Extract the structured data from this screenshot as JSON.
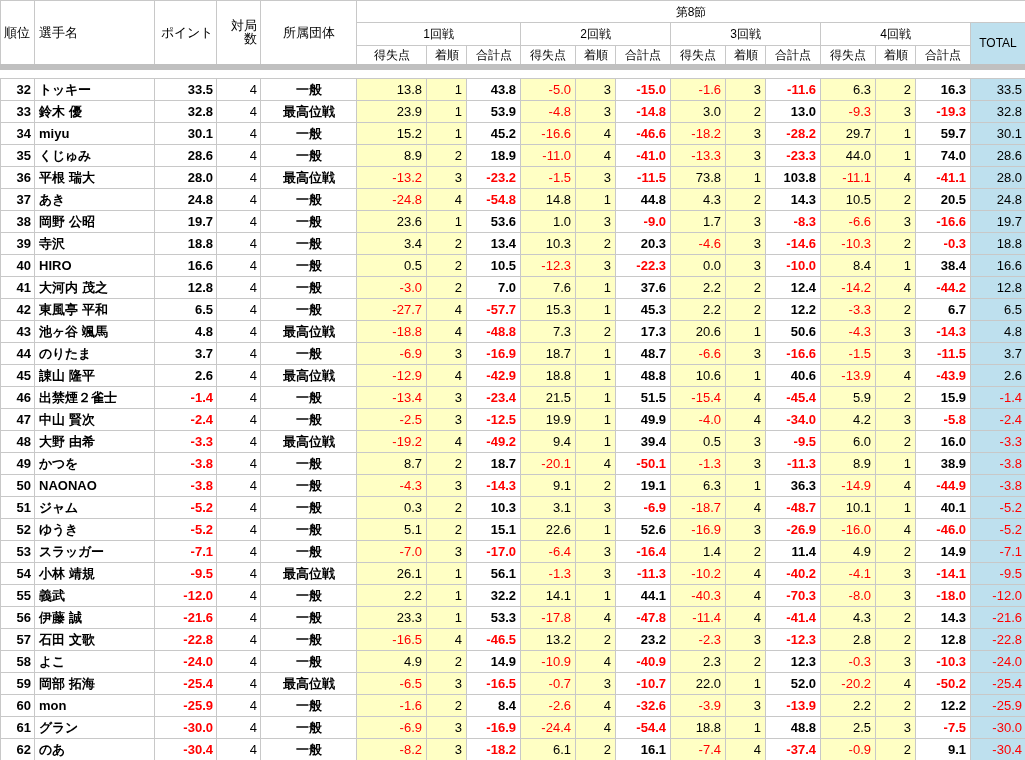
{
  "header": {
    "columns": [
      "順位",
      "選手名",
      "ポイント",
      "対局数",
      "所属団体"
    ],
    "section": "第8節",
    "rounds": [
      {
        "title": "1回戦",
        "columns": [
          "得失点",
          "着順",
          "合計点"
        ]
      },
      {
        "title": "2回戦",
        "columns": [
          "得失点",
          "着順",
          "合計点"
        ]
      },
      {
        "title": "3回戦",
        "columns": [
          "得失点",
          "着順",
          "合計点"
        ]
      },
      {
        "title": "4回戦",
        "columns": [
          "得失点",
          "着順",
          "合計点"
        ]
      }
    ],
    "total": "TOTAL"
  },
  "rows": [
    {
      "rank": "32",
      "name": "トッキー",
      "points": "33.5",
      "games": "4",
      "org": "一般",
      "rounds": [
        [
          "13.8",
          "1",
          "43.8"
        ],
        [
          "-5.0",
          "3",
          "-15.0"
        ],
        [
          "-1.6",
          "3",
          "-11.6"
        ],
        [
          "6.3",
          "2",
          "16.3"
        ]
      ],
      "total": "33.5"
    },
    {
      "rank": "33",
      "name": "鈴木 優",
      "points": "32.8",
      "games": "4",
      "org": "最高位戦",
      "rounds": [
        [
          "23.9",
          "1",
          "53.9"
        ],
        [
          "-4.8",
          "3",
          "-14.8"
        ],
        [
          "3.0",
          "2",
          "13.0"
        ],
        [
          "-9.3",
          "3",
          "-19.3"
        ]
      ],
      "total": "32.8"
    },
    {
      "rank": "34",
      "name": "miyu",
      "points": "30.1",
      "games": "4",
      "org": "一般",
      "rounds": [
        [
          "15.2",
          "1",
          "45.2"
        ],
        [
          "-16.6",
          "4",
          "-46.6"
        ],
        [
          "-18.2",
          "3",
          "-28.2"
        ],
        [
          "29.7",
          "1",
          "59.7"
        ]
      ],
      "total": "30.1"
    },
    {
      "rank": "35",
      "name": "くじゅみ",
      "points": "28.6",
      "games": "4",
      "org": "一般",
      "rounds": [
        [
          "8.9",
          "2",
          "18.9"
        ],
        [
          "-11.0",
          "4",
          "-41.0"
        ],
        [
          "-13.3",
          "3",
          "-23.3"
        ],
        [
          "44.0",
          "1",
          "74.0"
        ]
      ],
      "total": "28.6"
    },
    {
      "rank": "36",
      "name": "平根 瑞大",
      "points": "28.0",
      "games": "4",
      "org": "最高位戦",
      "rounds": [
        [
          "-13.2",
          "3",
          "-23.2"
        ],
        [
          "-1.5",
          "3",
          "-11.5"
        ],
        [
          "73.8",
          "1",
          "103.8"
        ],
        [
          "-11.1",
          "4",
          "-41.1"
        ]
      ],
      "total": "28.0"
    },
    {
      "rank": "37",
      "name": "あき",
      "points": "24.8",
      "games": "4",
      "org": "一般",
      "rounds": [
        [
          "-24.8",
          "4",
          "-54.8"
        ],
        [
          "14.8",
          "1",
          "44.8"
        ],
        [
          "4.3",
          "2",
          "14.3"
        ],
        [
          "10.5",
          "2",
          "20.5"
        ]
      ],
      "total": "24.8"
    },
    {
      "rank": "38",
      "name": "岡野 公昭",
      "points": "19.7",
      "games": "4",
      "org": "一般",
      "rounds": [
        [
          "23.6",
          "1",
          "53.6"
        ],
        [
          "1.0",
          "3",
          "-9.0"
        ],
        [
          "1.7",
          "3",
          "-8.3"
        ],
        [
          "-6.6",
          "3",
          "-16.6"
        ]
      ],
      "total": "19.7"
    },
    {
      "rank": "39",
      "name": "寺沢",
      "points": "18.8",
      "games": "4",
      "org": "一般",
      "rounds": [
        [
          "3.4",
          "2",
          "13.4"
        ],
        [
          "10.3",
          "2",
          "20.3"
        ],
        [
          "-4.6",
          "3",
          "-14.6"
        ],
        [
          "-10.3",
          "2",
          "-0.3"
        ]
      ],
      "total": "18.8"
    },
    {
      "rank": "40",
      "name": "HIRO",
      "points": "16.6",
      "games": "4",
      "org": "一般",
      "rounds": [
        [
          "0.5",
          "2",
          "10.5"
        ],
        [
          "-12.3",
          "3",
          "-22.3"
        ],
        [
          "0.0",
          "3",
          "-10.0"
        ],
        [
          "8.4",
          "1",
          "38.4"
        ]
      ],
      "total": "16.6"
    },
    {
      "rank": "41",
      "name": "大河内 茂之",
      "points": "12.8",
      "games": "4",
      "org": "一般",
      "rounds": [
        [
          "-3.0",
          "2",
          "7.0"
        ],
        [
          "7.6",
          "1",
          "37.6"
        ],
        [
          "2.2",
          "2",
          "12.4"
        ],
        [
          "-14.2",
          "4",
          "-44.2"
        ]
      ],
      "total": "12.8"
    },
    {
      "rank": "42",
      "name": "東風亭 平和",
      "points": "6.5",
      "games": "4",
      "org": "一般",
      "rounds": [
        [
          "-27.7",
          "4",
          "-57.7"
        ],
        [
          "15.3",
          "1",
          "45.3"
        ],
        [
          "2.2",
          "2",
          "12.2"
        ],
        [
          "-3.3",
          "2",
          "6.7"
        ]
      ],
      "total": "6.5"
    },
    {
      "rank": "43",
      "name": "池ヶ谷 颯馬",
      "points": "4.8",
      "games": "4",
      "org": "最高位戦",
      "rounds": [
        [
          "-18.8",
          "4",
          "-48.8"
        ],
        [
          "7.3",
          "2",
          "17.3"
        ],
        [
          "20.6",
          "1",
          "50.6"
        ],
        [
          "-4.3",
          "3",
          "-14.3"
        ]
      ],
      "total": "4.8"
    },
    {
      "rank": "44",
      "name": "のりたま",
      "points": "3.7",
      "games": "4",
      "org": "一般",
      "rounds": [
        [
          "-6.9",
          "3",
          "-16.9"
        ],
        [
          "18.7",
          "1",
          "48.7"
        ],
        [
          "-6.6",
          "3",
          "-16.6"
        ],
        [
          "-1.5",
          "3",
          "-11.5"
        ]
      ],
      "total": "3.7"
    },
    {
      "rank": "45",
      "name": "諌山 隆平",
      "points": "2.6",
      "games": "4",
      "org": "最高位戦",
      "rounds": [
        [
          "-12.9",
          "4",
          "-42.9"
        ],
        [
          "18.8",
          "1",
          "48.8"
        ],
        [
          "10.6",
          "1",
          "40.6"
        ],
        [
          "-13.9",
          "4",
          "-43.9"
        ]
      ],
      "total": "2.6"
    },
    {
      "rank": "46",
      "name": "出禁煙２雀士",
      "points": "-1.4",
      "games": "4",
      "org": "一般",
      "rounds": [
        [
          "-13.4",
          "3",
          "-23.4"
        ],
        [
          "21.5",
          "1",
          "51.5"
        ],
        [
          "-15.4",
          "4",
          "-45.4"
        ],
        [
          "5.9",
          "2",
          "15.9"
        ]
      ],
      "total": "-1.4"
    },
    {
      "rank": "47",
      "name": "中山 賢次",
      "points": "-2.4",
      "games": "4",
      "org": "一般",
      "rounds": [
        [
          "-2.5",
          "3",
          "-12.5"
        ],
        [
          "19.9",
          "1",
          "49.9"
        ],
        [
          "-4.0",
          "4",
          "-34.0"
        ],
        [
          "4.2",
          "3",
          "-5.8"
        ]
      ],
      "total": "-2.4"
    },
    {
      "rank": "48",
      "name": "大野 由希",
      "points": "-3.3",
      "games": "4",
      "org": "最高位戦",
      "rounds": [
        [
          "-19.2",
          "4",
          "-49.2"
        ],
        [
          "9.4",
          "1",
          "39.4"
        ],
        [
          "0.5",
          "3",
          "-9.5"
        ],
        [
          "6.0",
          "2",
          "16.0"
        ]
      ],
      "total": "-3.3"
    },
    {
      "rank": "49",
      "name": "かつを",
      "points": "-3.8",
      "games": "4",
      "org": "一般",
      "rounds": [
        [
          "8.7",
          "2",
          "18.7"
        ],
        [
          "-20.1",
          "4",
          "-50.1"
        ],
        [
          "-1.3",
          "3",
          "-11.3"
        ],
        [
          "8.9",
          "1",
          "38.9"
        ]
      ],
      "total": "-3.8"
    },
    {
      "rank": "50",
      "name": "NAONAO",
      "points": "-3.8",
      "games": "4",
      "org": "一般",
      "rounds": [
        [
          "-4.3",
          "3",
          "-14.3"
        ],
        [
          "9.1",
          "2",
          "19.1"
        ],
        [
          "6.3",
          "1",
          "36.3"
        ],
        [
          "-14.9",
          "4",
          "-44.9"
        ]
      ],
      "total": "-3.8"
    },
    {
      "rank": "51",
      "name": "ジャム",
      "points": "-5.2",
      "games": "4",
      "org": "一般",
      "rounds": [
        [
          "0.3",
          "2",
          "10.3"
        ],
        [
          "3.1",
          "3",
          "-6.9"
        ],
        [
          "-18.7",
          "4",
          "-48.7"
        ],
        [
          "10.1",
          "1",
          "40.1"
        ]
      ],
      "total": "-5.2"
    },
    {
      "rank": "52",
      "name": "ゆうき",
      "points": "-5.2",
      "games": "4",
      "org": "一般",
      "rounds": [
        [
          "5.1",
          "2",
          "15.1"
        ],
        [
          "22.6",
          "1",
          "52.6"
        ],
        [
          "-16.9",
          "3",
          "-26.9"
        ],
        [
          "-16.0",
          "4",
          "-46.0"
        ]
      ],
      "total": "-5.2"
    },
    {
      "rank": "53",
      "name": "スラッガー",
      "points": "-7.1",
      "games": "4",
      "org": "一般",
      "rounds": [
        [
          "-7.0",
          "3",
          "-17.0"
        ],
        [
          "-6.4",
          "3",
          "-16.4"
        ],
        [
          "1.4",
          "2",
          "11.4"
        ],
        [
          "4.9",
          "2",
          "14.9"
        ]
      ],
      "total": "-7.1"
    },
    {
      "rank": "54",
      "name": "小林 靖規",
      "points": "-9.5",
      "games": "4",
      "org": "最高位戦",
      "rounds": [
        [
          "26.1",
          "1",
          "56.1"
        ],
        [
          "-1.3",
          "3",
          "-11.3"
        ],
        [
          "-10.2",
          "4",
          "-40.2"
        ],
        [
          "-4.1",
          "3",
          "-14.1"
        ]
      ],
      "total": "-9.5"
    },
    {
      "rank": "55",
      "name": "義武",
      "points": "-12.0",
      "games": "4",
      "org": "一般",
      "rounds": [
        [
          "2.2",
          "1",
          "32.2"
        ],
        [
          "14.1",
          "1",
          "44.1"
        ],
        [
          "-40.3",
          "4",
          "-70.3"
        ],
        [
          "-8.0",
          "3",
          "-18.0"
        ]
      ],
      "total": "-12.0"
    },
    {
      "rank": "56",
      "name": "伊藤 誠",
      "points": "-21.6",
      "games": "4",
      "org": "一般",
      "rounds": [
        [
          "23.3",
          "1",
          "53.3"
        ],
        [
          "-17.8",
          "4",
          "-47.8"
        ],
        [
          "-11.4",
          "4",
          "-41.4"
        ],
        [
          "4.3",
          "2",
          "14.3"
        ]
      ],
      "total": "-21.6"
    },
    {
      "rank": "57",
      "name": "石田 文歌",
      "points": "-22.8",
      "games": "4",
      "org": "一般",
      "rounds": [
        [
          "-16.5",
          "4",
          "-46.5"
        ],
        [
          "13.2",
          "2",
          "23.2"
        ],
        [
          "-2.3",
          "3",
          "-12.3"
        ],
        [
          "2.8",
          "2",
          "12.8"
        ]
      ],
      "total": "-22.8"
    },
    {
      "rank": "58",
      "name": "よこ",
      "points": "-24.0",
      "games": "4",
      "org": "一般",
      "rounds": [
        [
          "4.9",
          "2",
          "14.9"
        ],
        [
          "-10.9",
          "4",
          "-40.9"
        ],
        [
          "2.3",
          "2",
          "12.3"
        ],
        [
          "-0.3",
          "3",
          "-10.3"
        ]
      ],
      "total": "-24.0"
    },
    {
      "rank": "59",
      "name": "岡部 拓海",
      "points": "-25.4",
      "games": "4",
      "org": "最高位戦",
      "rounds": [
        [
          "-6.5",
          "3",
          "-16.5"
        ],
        [
          "-0.7",
          "3",
          "-10.7"
        ],
        [
          "22.0",
          "1",
          "52.0"
        ],
        [
          "-20.2",
          "4",
          "-50.2"
        ]
      ],
      "total": "-25.4"
    },
    {
      "rank": "60",
      "name": "mon",
      "points": "-25.9",
      "games": "4",
      "org": "一般",
      "rounds": [
        [
          "-1.6",
          "2",
          "8.4"
        ],
        [
          "-2.6",
          "4",
          "-32.6"
        ],
        [
          "-3.9",
          "3",
          "-13.9"
        ],
        [
          "2.2",
          "2",
          "12.2"
        ]
      ],
      "total": "-25.9"
    },
    {
      "rank": "61",
      "name": "グラン",
      "points": "-30.0",
      "games": "4",
      "org": "一般",
      "rounds": [
        [
          "-6.9",
          "3",
          "-16.9"
        ],
        [
          "-24.4",
          "4",
          "-54.4"
        ],
        [
          "18.8",
          "1",
          "48.8"
        ],
        [
          "2.5",
          "3",
          "-7.5"
        ]
      ],
      "total": "-30.0"
    },
    {
      "rank": "62",
      "name": "のあ",
      "points": "-30.4",
      "games": "4",
      "org": "一般",
      "rounds": [
        [
          "-8.2",
          "3",
          "-18.2"
        ],
        [
          "6.1",
          "2",
          "16.1"
        ],
        [
          "-7.4",
          "4",
          "-37.4"
        ],
        [
          "-0.9",
          "2",
          "9.1"
        ]
      ],
      "total": "-30.4"
    }
  ]
}
